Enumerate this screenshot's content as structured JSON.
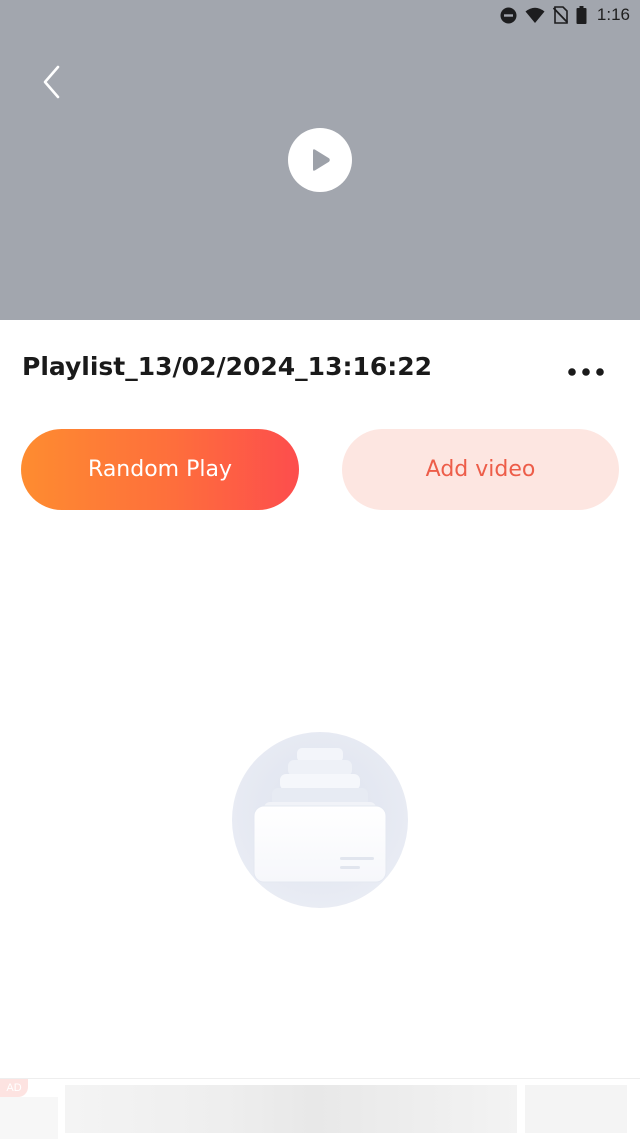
{
  "status_bar": {
    "time": "1:16",
    "icons": [
      "do-not-disturb-icon",
      "wifi-icon",
      "no-sim-icon",
      "battery-icon"
    ]
  },
  "header": {
    "background_color": "#a2a6ae",
    "back_icon": "chevron-left-icon",
    "play_icon": "play-circle-icon"
  },
  "playlist": {
    "title": "Playlist_13/02/2024_13:16:22",
    "more_icon": "more-horizontal-icon"
  },
  "actions": {
    "random_play_label": "Random Play",
    "add_video_label": "Add video",
    "random_play_colors": [
      "#fe8c30",
      "#fd4d4d"
    ],
    "add_video_bg": "#fde6e1",
    "add_video_text_color": "#ed5d49"
  },
  "empty_state": {
    "icon": "empty-box-icon"
  },
  "ad": {
    "badge": "AD"
  }
}
